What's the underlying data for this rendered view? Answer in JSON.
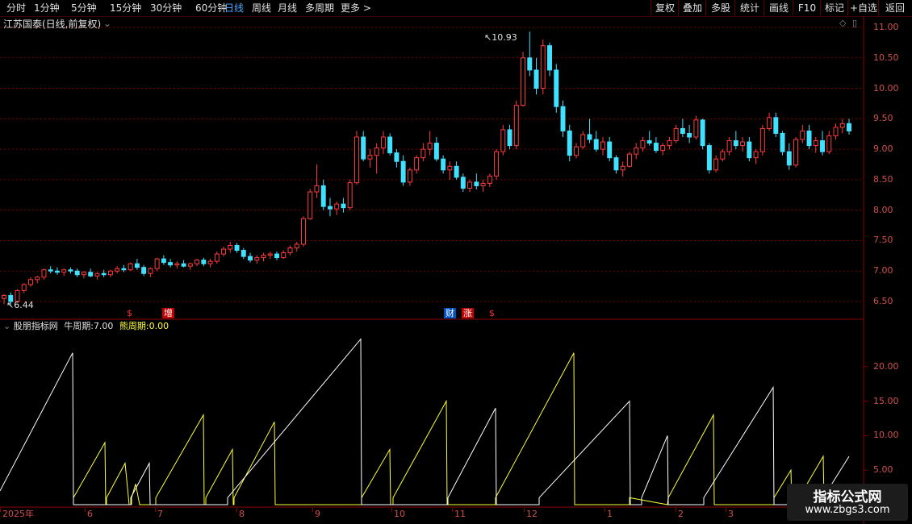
{
  "toolbar": {
    "periods": [
      "分时",
      "1分钟",
      "5分钟",
      "15分钟",
      "30分钟",
      "60分钟",
      "日线",
      "周线",
      "月线",
      "多周期",
      "更多 >"
    ],
    "active_period": "日线",
    "right_buttons": [
      "复权",
      "叠加",
      "多股",
      "统计",
      "画线",
      "F10",
      "标记",
      "+自选",
      "返回"
    ]
  },
  "kline": {
    "title": "江苏国泰(日线,前复权)",
    "high_label": "10.93",
    "low_label": "6.44",
    "price_ticks": [
      "11.00",
      "10.50",
      "10.00",
      "9.50",
      "9.00",
      "8.50",
      "8.00",
      "7.50",
      "7.00",
      "6.50"
    ],
    "markers": [
      {
        "text": "$",
        "color": "#ff3030"
      },
      {
        "text": "增",
        "color": "#ffffff",
        "bg": "#c00000"
      },
      {
        "text": "财",
        "color": "#ffffff",
        "bg": "#0050c0"
      },
      {
        "text": "涨",
        "color": "#ffffff",
        "bg": "#c00000"
      },
      {
        "text": "$",
        "color": "#ff3030"
      }
    ],
    "up_color": "#ff3b3b",
    "down_color": "#40e0ff"
  },
  "indicator": {
    "name": "股朋指标网",
    "bull_label": "牛周期:",
    "bull_value": "7.00",
    "bear_label": "熊周期:",
    "bear_value": "0.00",
    "ticks": [
      "20.00",
      "15.00",
      "10.00",
      "5.00"
    ],
    "bull_color": "#ffffff",
    "bear_color": "#ffff33"
  },
  "time_axis": [
    "2025年",
    "6",
    "7",
    "8",
    "9",
    "10",
    "11",
    "12",
    "1",
    "2",
    "3"
  ],
  "watermark": {
    "line1": "指标公式网",
    "line2": "www.zbgs3.com"
  },
  "chart_data": {
    "type": "candlestick",
    "price_ylim": [
      6.3,
      11.2
    ],
    "candles": [
      [
        6.55,
        6.62,
        6.46,
        6.6
      ],
      [
        6.6,
        6.65,
        6.44,
        6.5
      ],
      [
        6.5,
        6.7,
        6.48,
        6.68
      ],
      [
        6.68,
        6.8,
        6.64,
        6.78
      ],
      [
        6.78,
        6.9,
        6.74,
        6.86
      ],
      [
        6.86,
        6.92,
        6.8,
        6.9
      ],
      [
        6.9,
        7.04,
        6.86,
        7.02
      ],
      [
        7.02,
        7.08,
        6.96,
        7.0
      ],
      [
        7.0,
        7.06,
        6.94,
        6.98
      ],
      [
        6.98,
        7.04,
        6.92,
        7.02
      ],
      [
        7.02,
        7.06,
        6.96,
        7.0
      ],
      [
        7.0,
        7.04,
        6.9,
        6.94
      ],
      [
        6.94,
        7.0,
        6.88,
        6.98
      ],
      [
        6.98,
        7.04,
        6.9,
        6.92
      ],
      [
        6.92,
        6.98,
        6.86,
        6.96
      ],
      [
        6.96,
        7.02,
        6.9,
        6.94
      ],
      [
        6.94,
        7.02,
        6.9,
        7.0
      ],
      [
        7.0,
        7.08,
        6.96,
        7.04
      ],
      [
        7.04,
        7.1,
        6.98,
        7.02
      ],
      [
        7.02,
        7.14,
        7.0,
        7.12
      ],
      [
        7.12,
        7.2,
        7.02,
        7.06
      ],
      [
        7.06,
        7.1,
        6.92,
        6.96
      ],
      [
        6.96,
        7.06,
        6.9,
        7.04
      ],
      [
        7.04,
        7.22,
        7.0,
        7.2
      ],
      [
        7.2,
        7.26,
        7.1,
        7.14
      ],
      [
        7.14,
        7.2,
        7.06,
        7.1
      ],
      [
        7.1,
        7.16,
        7.04,
        7.12
      ],
      [
        7.12,
        7.18,
        7.06,
        7.08
      ],
      [
        7.08,
        7.14,
        7.02,
        7.12
      ],
      [
        7.12,
        7.2,
        7.08,
        7.18
      ],
      [
        7.18,
        7.22,
        7.08,
        7.12
      ],
      [
        7.12,
        7.2,
        7.06,
        7.16
      ],
      [
        7.16,
        7.32,
        7.12,
        7.28
      ],
      [
        7.28,
        7.4,
        7.24,
        7.36
      ],
      [
        7.36,
        7.48,
        7.3,
        7.42
      ],
      [
        7.42,
        7.46,
        7.3,
        7.34
      ],
      [
        7.34,
        7.38,
        7.2,
        7.24
      ],
      [
        7.24,
        7.3,
        7.14,
        7.18
      ],
      [
        7.18,
        7.26,
        7.12,
        7.22
      ],
      [
        7.22,
        7.3,
        7.16,
        7.26
      ],
      [
        7.26,
        7.32,
        7.2,
        7.28
      ],
      [
        7.28,
        7.32,
        7.18,
        7.22
      ],
      [
        7.22,
        7.34,
        7.2,
        7.3
      ],
      [
        7.3,
        7.42,
        7.26,
        7.38
      ],
      [
        7.38,
        7.48,
        7.32,
        7.44
      ],
      [
        7.44,
        7.9,
        7.4,
        7.86
      ],
      [
        7.86,
        8.35,
        7.84,
        8.3
      ],
      [
        8.3,
        8.75,
        8.2,
        8.4
      ],
      [
        8.4,
        8.5,
        8.0,
        8.06
      ],
      [
        8.06,
        8.2,
        7.9,
        8.02
      ],
      [
        8.02,
        8.14,
        7.92,
        8.1
      ],
      [
        8.1,
        8.2,
        7.96,
        8.04
      ],
      [
        8.04,
        8.5,
        8.0,
        8.45
      ],
      [
        8.45,
        9.3,
        8.42,
        9.2
      ],
      [
        9.2,
        9.3,
        8.8,
        8.84
      ],
      [
        8.84,
        9.0,
        8.7,
        8.9
      ],
      [
        8.9,
        9.1,
        8.6,
        9.02
      ],
      [
        9.02,
        9.3,
        8.92,
        9.2
      ],
      [
        9.2,
        9.26,
        8.9,
        8.94
      ],
      [
        8.94,
        9.0,
        8.7,
        8.8
      ],
      [
        8.8,
        8.9,
        8.4,
        8.46
      ],
      [
        8.46,
        8.7,
        8.4,
        8.66
      ],
      [
        8.66,
        8.9,
        8.6,
        8.86
      ],
      [
        8.86,
        9.1,
        8.8,
        9.0
      ],
      [
        9.0,
        9.3,
        8.9,
        9.1
      ],
      [
        9.1,
        9.2,
        8.8,
        8.84
      ],
      [
        8.84,
        8.9,
        8.6,
        8.66
      ],
      [
        8.66,
        8.8,
        8.5,
        8.72
      ],
      [
        8.72,
        8.8,
        8.5,
        8.54
      ],
      [
        8.54,
        8.6,
        8.3,
        8.36
      ],
      [
        8.36,
        8.5,
        8.3,
        8.46
      ],
      [
        8.46,
        8.6,
        8.34,
        8.4
      ],
      [
        8.4,
        8.5,
        8.3,
        8.44
      ],
      [
        8.44,
        8.6,
        8.38,
        8.56
      ],
      [
        8.56,
        9.0,
        8.5,
        8.96
      ],
      [
        8.96,
        9.4,
        8.9,
        9.32
      ],
      [
        9.32,
        9.4,
        9.0,
        9.06
      ],
      [
        9.06,
        9.8,
        9.0,
        9.72
      ],
      [
        9.72,
        10.6,
        9.7,
        10.5
      ],
      [
        10.5,
        10.93,
        10.2,
        10.3
      ],
      [
        10.3,
        10.5,
        9.9,
        10.0
      ],
      [
        10.0,
        10.8,
        9.9,
        10.7
      ],
      [
        10.7,
        10.75,
        10.2,
        10.3
      ],
      [
        10.3,
        10.4,
        9.6,
        9.7
      ],
      [
        9.7,
        9.8,
        9.2,
        9.3
      ],
      [
        9.3,
        9.4,
        8.8,
        8.9
      ],
      [
        8.9,
        9.1,
        8.85,
        9.04
      ],
      [
        9.04,
        9.3,
        9.0,
        9.24
      ],
      [
        9.24,
        9.5,
        9.1,
        9.16
      ],
      [
        9.16,
        9.3,
        8.96,
        9.0
      ],
      [
        9.0,
        9.2,
        8.9,
        9.12
      ],
      [
        9.12,
        9.2,
        8.8,
        8.86
      ],
      [
        8.86,
        8.9,
        8.6,
        8.66
      ],
      [
        8.66,
        8.8,
        8.55,
        8.72
      ],
      [
        8.72,
        8.96,
        8.7,
        8.92
      ],
      [
        8.92,
        9.1,
        8.84,
        9.02
      ],
      [
        9.02,
        9.2,
        8.96,
        9.14
      ],
      [
        9.14,
        9.3,
        9.06,
        9.1
      ],
      [
        9.1,
        9.2,
        8.94,
        8.98
      ],
      [
        8.98,
        9.1,
        8.9,
        9.06
      ],
      [
        9.06,
        9.2,
        9.0,
        9.14
      ],
      [
        9.14,
        9.4,
        9.1,
        9.34
      ],
      [
        9.34,
        9.5,
        9.2,
        9.26
      ],
      [
        9.26,
        9.4,
        9.1,
        9.2
      ],
      [
        9.2,
        9.55,
        9.16,
        9.48
      ],
      [
        9.48,
        9.5,
        9.0,
        9.06
      ],
      [
        9.06,
        9.1,
        8.6,
        8.66
      ],
      [
        8.66,
        8.9,
        8.62,
        8.84
      ],
      [
        8.84,
        9.0,
        8.8,
        8.96
      ],
      [
        8.96,
        9.2,
        8.9,
        9.14
      ],
      [
        9.14,
        9.3,
        9.0,
        9.06
      ],
      [
        9.06,
        9.2,
        8.96,
        9.12
      ],
      [
        9.12,
        9.2,
        8.8,
        8.86
      ],
      [
        8.86,
        9.0,
        8.76,
        8.96
      ],
      [
        8.96,
        9.4,
        8.9,
        9.34
      ],
      [
        9.34,
        9.6,
        9.3,
        9.52
      ],
      [
        9.52,
        9.6,
        9.2,
        9.26
      ],
      [
        9.26,
        9.3,
        8.9,
        8.96
      ],
      [
        8.96,
        9.1,
        8.66,
        8.74
      ],
      [
        8.74,
        9.2,
        8.7,
        9.16
      ],
      [
        9.16,
        9.4,
        9.1,
        9.3
      ],
      [
        9.3,
        9.4,
        9.0,
        9.06
      ],
      [
        9.06,
        9.2,
        8.94,
        9.14
      ],
      [
        9.14,
        9.3,
        8.9,
        8.96
      ],
      [
        8.96,
        9.3,
        8.92,
        9.22
      ],
      [
        9.22,
        9.42,
        9.16,
        9.36
      ],
      [
        9.36,
        9.5,
        9.26,
        9.42
      ],
      [
        9.42,
        9.5,
        9.24,
        9.3
      ]
    ],
    "indicator_ylim": [
      0,
      25
    ],
    "bull_series": [
      [
        0,
        2
      ],
      [
        90,
        22
      ],
      [
        91,
        0
      ],
      [
        162,
        0
      ],
      [
        162,
        1
      ],
      [
        185,
        6
      ],
      [
        186,
        0
      ],
      [
        282,
        0
      ],
      [
        282,
        1
      ],
      [
        447,
        24
      ],
      [
        448,
        0
      ],
      [
        555,
        0
      ],
      [
        555,
        1
      ],
      [
        614,
        14
      ],
      [
        615,
        0
      ],
      [
        668,
        0
      ],
      [
        668,
        1
      ],
      [
        780,
        15
      ],
      [
        781,
        0
      ],
      [
        795,
        0
      ],
      [
        795,
        1
      ],
      [
        827,
        10
      ],
      [
        828,
        0
      ],
      [
        872,
        0
      ],
      [
        872,
        1
      ],
      [
        958,
        17
      ],
      [
        959,
        0
      ],
      [
        1020,
        0
      ],
      [
        1020,
        1
      ],
      [
        1052,
        7
      ]
    ],
    "bear_series": [
      [
        91,
        0
      ],
      [
        91,
        1
      ],
      [
        130,
        9
      ],
      [
        131,
        0
      ],
      [
        132,
        0
      ],
      [
        132,
        1
      ],
      [
        155,
        6
      ],
      [
        160,
        0
      ],
      [
        163,
        0
      ],
      [
        163,
        1
      ],
      [
        168,
        3
      ],
      [
        173,
        0
      ],
      [
        193,
        0
      ],
      [
        193,
        1
      ],
      [
        252,
        13
      ],
      [
        253,
        0
      ],
      [
        255,
        0
      ],
      [
        255,
        1
      ],
      [
        288,
        8
      ],
      [
        289,
        0
      ],
      [
        290,
        0
      ],
      [
        290,
        1
      ],
      [
        340,
        12
      ],
      [
        341,
        0
      ],
      [
        448,
        0
      ],
      [
        448,
        1
      ],
      [
        483,
        8
      ],
      [
        484,
        0
      ],
      [
        487,
        0
      ],
      [
        487,
        1
      ],
      [
        553,
        15
      ],
      [
        554,
        0
      ],
      [
        614,
        0
      ],
      [
        614,
        1
      ],
      [
        711,
        22
      ],
      [
        712,
        0
      ],
      [
        780,
        0
      ],
      [
        780,
        1
      ],
      [
        827,
        0
      ],
      [
        828,
        1
      ],
      [
        884,
        13
      ],
      [
        885,
        0
      ],
      [
        959,
        0
      ],
      [
        959,
        1
      ],
      [
        980,
        5
      ],
      [
        981,
        0
      ],
      [
        990,
        0
      ],
      [
        990,
        1
      ],
      [
        1020,
        7
      ],
      [
        1021,
        0
      ]
    ]
  }
}
